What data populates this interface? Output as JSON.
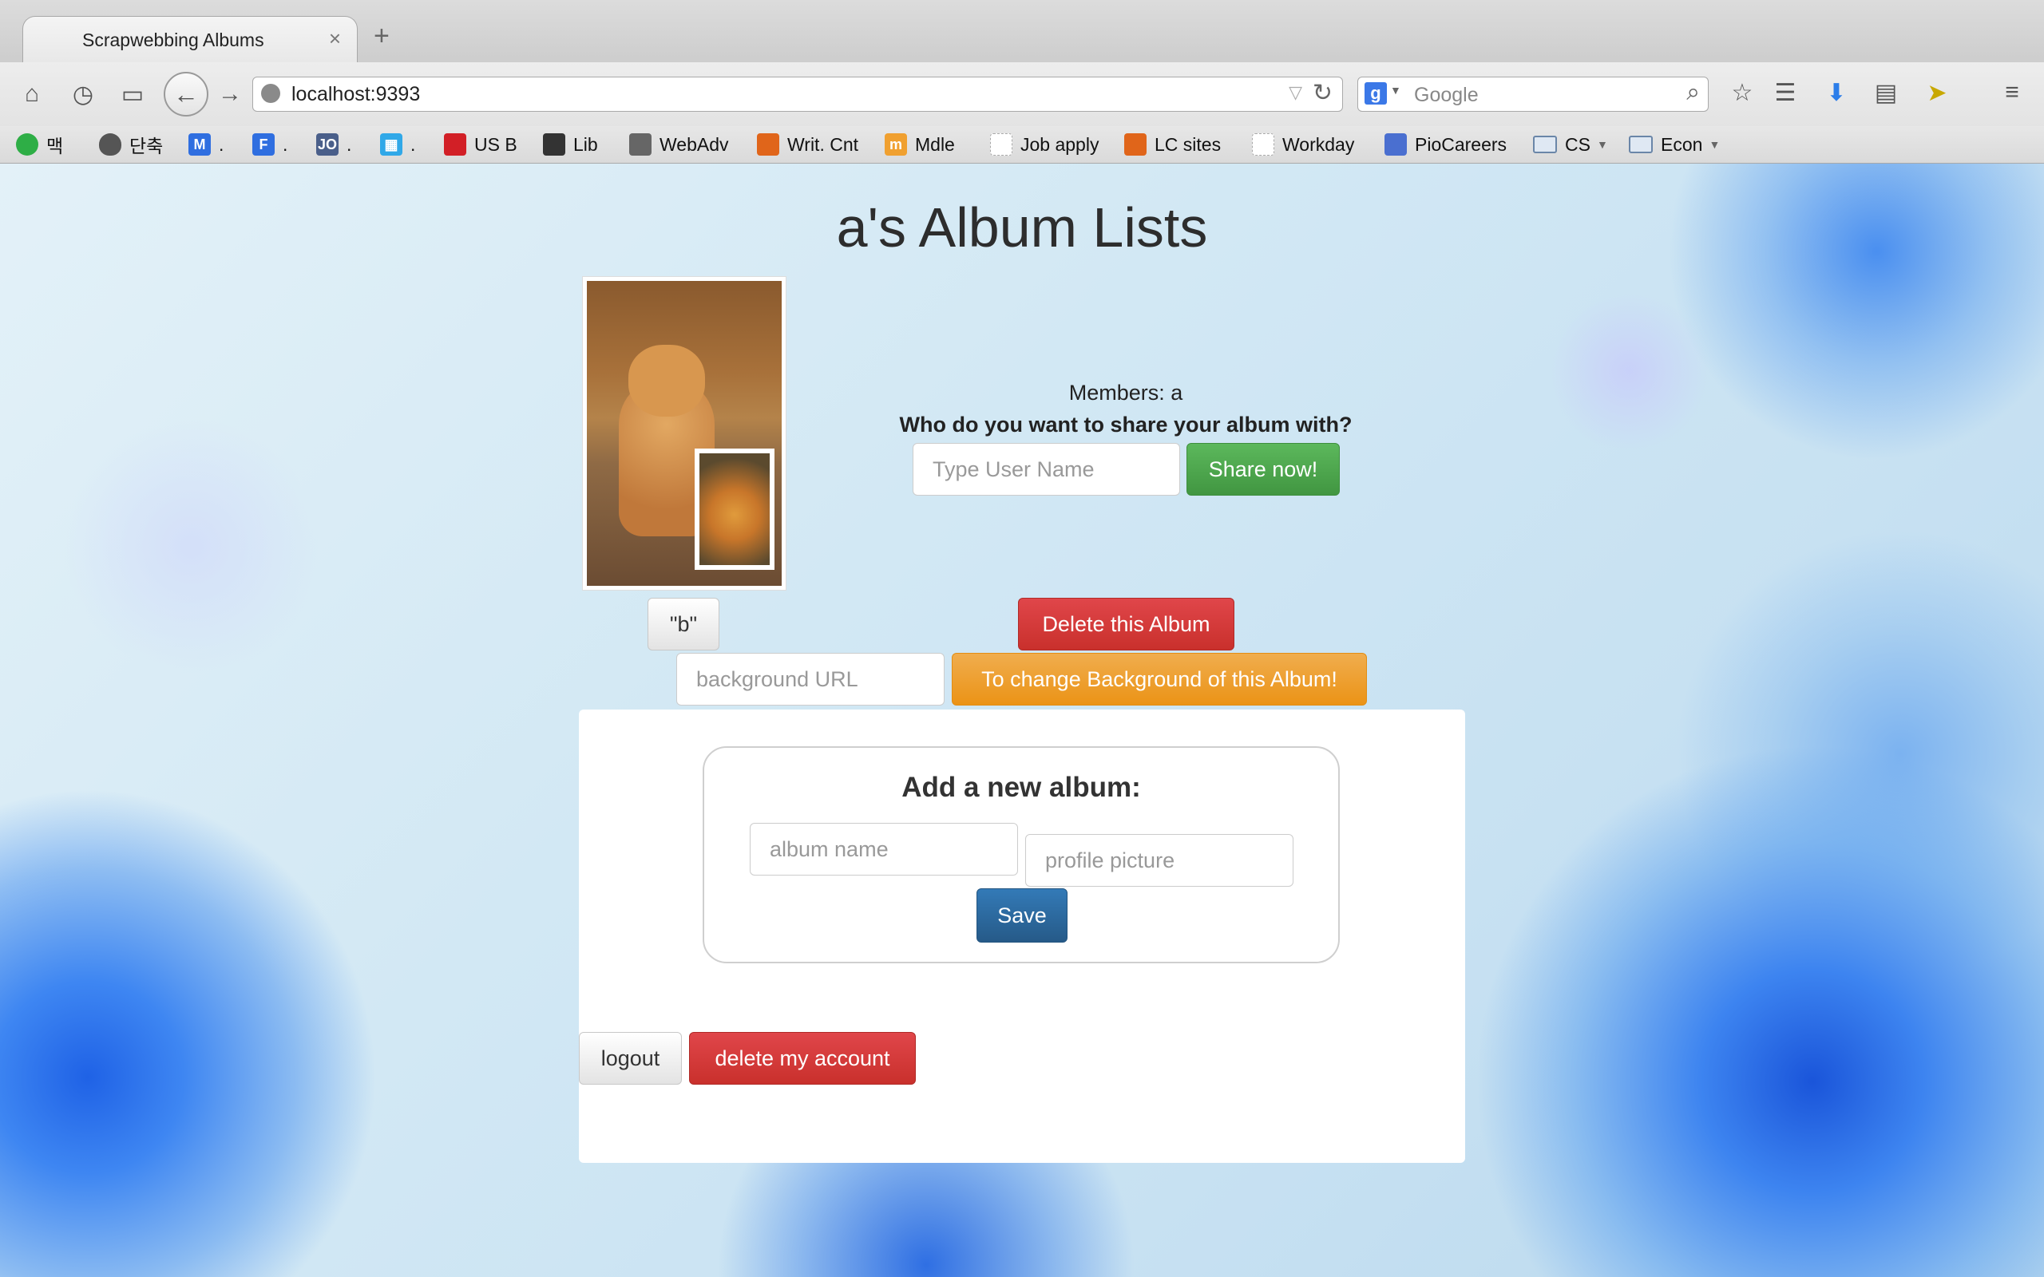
{
  "browser": {
    "tab_title": "Scrapwebbing Albums",
    "tab_close": "×",
    "new_tab": "+",
    "url": "localhost:9393",
    "search_engine_badge": "g",
    "search_placeholder": "Google"
  },
  "bookmarks": [
    {
      "label": "맥",
      "icon": "green-circle-icon",
      "color": "#2eae46"
    },
    {
      "label": "단축",
      "icon": "apple-icon",
      "color": "#555555"
    },
    {
      "label": ".",
      "icon": "m-badge-icon",
      "color": "#2f6ee0",
      "glyph": "M"
    },
    {
      "label": ".",
      "icon": "f-badge-icon",
      "color": "#2f6ee0",
      "glyph": "F"
    },
    {
      "label": ".",
      "icon": "jo-badge-icon",
      "color": "#4a5f8a",
      "glyph": "JO"
    },
    {
      "label": ".",
      "icon": "grid-badge-icon",
      "color": "#30a8e8",
      "glyph": "▦"
    },
    {
      "label": "US B",
      "icon": "red-shield-icon",
      "color": "#d21f26"
    },
    {
      "label": "Lib",
      "icon": "building-icon",
      "color": "#333333"
    },
    {
      "label": "WebAdv",
      "icon": "image-icon",
      "color": "#666666"
    },
    {
      "label": "Writ. Cnt",
      "icon": "orange-shield-icon",
      "color": "#e0651a"
    },
    {
      "label": "Mdle",
      "icon": "moodle-icon",
      "color": "#f0a030",
      "glyph": "m"
    },
    {
      "label": "Job apply",
      "icon": "blank-page-icon",
      "color": "#dddddd"
    },
    {
      "label": "LC sites",
      "icon": "orange-shield-icon",
      "color": "#e0651a"
    },
    {
      "label": "Workday",
      "icon": "blank-page-icon",
      "color": "#dddddd"
    },
    {
      "label": "PioCareers",
      "icon": "blue-square-icon",
      "color": "#4a6fd0"
    },
    {
      "label": "CS",
      "icon": "folder-icon",
      "color": "#6a86a8"
    },
    {
      "label": "Econ",
      "icon": "folder-icon",
      "color": "#6a86a8"
    }
  ],
  "page": {
    "title": "a's Album Lists",
    "members_text": "Members: a",
    "share_question": "Who do you want to share your album with?",
    "share_input_placeholder": "Type User Name",
    "share_button": "Share now!",
    "album_button": "\"b\"",
    "delete_album_button": "Delete this Album",
    "background_url_placeholder": "background URL",
    "change_background_button": "To change Background of this Album!",
    "add_album_title": "Add a new album:",
    "album_name_placeholder": "album name",
    "profile_picture_placeholder": "profile picture",
    "save_button": "Save",
    "logout_button": "logout",
    "delete_account_button": "delete my account"
  },
  "colors": {
    "danger": "#c9302c",
    "success": "#449d44",
    "warning": "#ec971f",
    "primary": "#286090"
  }
}
